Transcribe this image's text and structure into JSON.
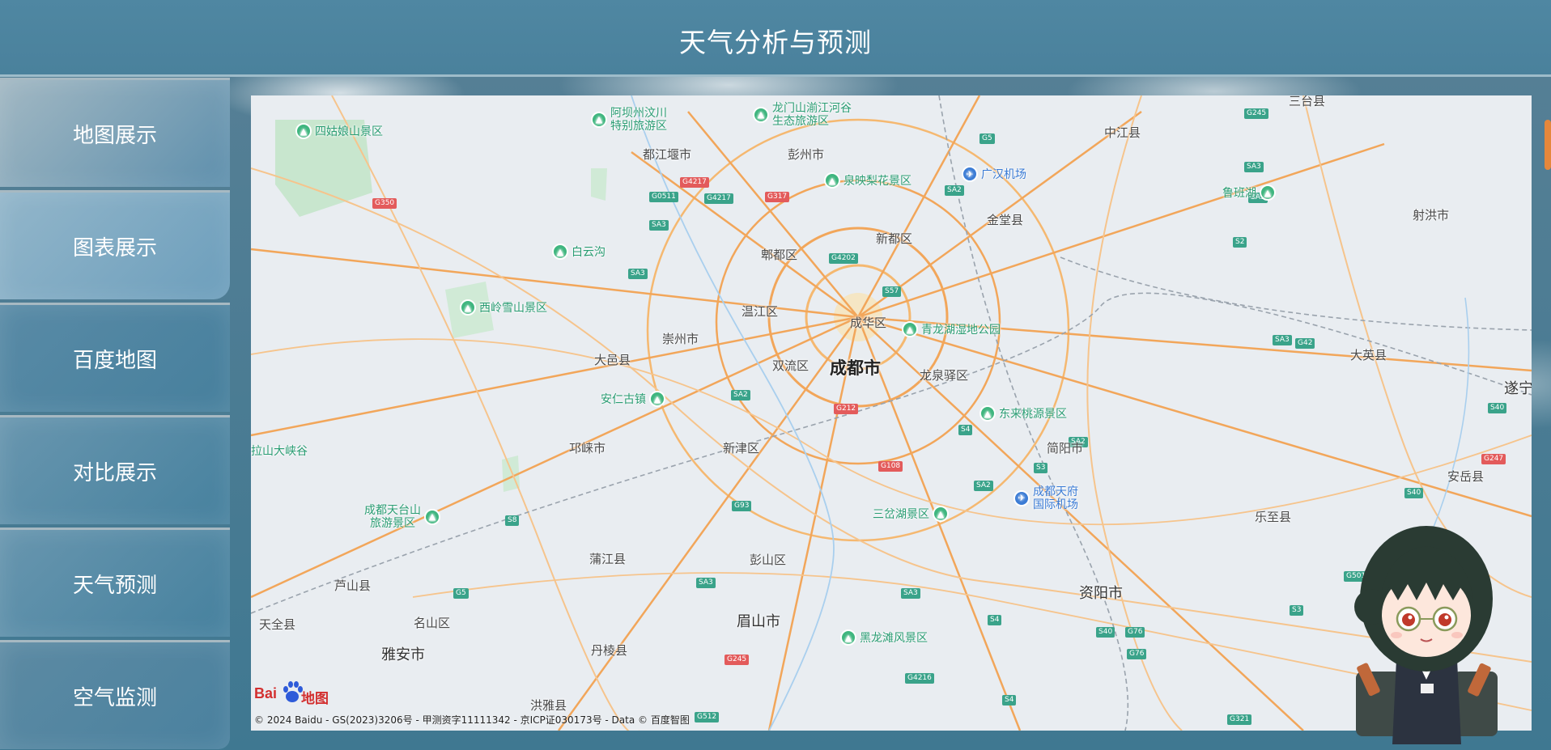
{
  "header": {
    "title": "天气分析与预测"
  },
  "sidebar": {
    "items": [
      {
        "label": "地图展示"
      },
      {
        "label": "图表展示"
      },
      {
        "label": "百度地图"
      },
      {
        "label": "对比展示"
      },
      {
        "label": "天气预测"
      },
      {
        "label": "空气监测"
      }
    ]
  },
  "map": {
    "places": {
      "chengdu": "成都市",
      "chenghua": "成华区",
      "xindu": "新都区",
      "pidu": "郫都区",
      "wenjiang": "温江区",
      "shuangliu": "双流区",
      "longquanyi": "龙泉驿区",
      "chongzhou": "崇州市",
      "dayi": "大邑县",
      "qionglai": "邛崃市",
      "xinjin": "新津区",
      "dujiangyan": "都江堰市",
      "pengzhou": "彭州市",
      "jintang": "金堂县",
      "zhongjiang": "中江县",
      "jianyang": "简阳市",
      "ziyang": "资阳市",
      "pujiang": "蒲江县",
      "pengshan": "彭山区",
      "meishan": "眉山市",
      "danling": "丹棱县",
      "mingshan": "名山区",
      "yaan": "雅安市",
      "lushan": "芦山县",
      "tianquan": "天全县",
      "hongya": "洪雅县",
      "lezhi": "乐至县",
      "anyue": "安岳县",
      "daying": "大英县",
      "shehong": "射洪市",
      "santai": "三台县",
      "suining": "遂宁"
    },
    "pois": {
      "siguniang": "四姑娘山景区",
      "aba": "阿坝州汶川\n特别旅游区",
      "longmenshan": "龙门山湔江河谷\n生态旅游区",
      "quanyin": "泉映梨花景区",
      "guanghan": "广汉机场",
      "baiyungou": "白云沟",
      "xiling": "西岭雪山景区",
      "qinglonghu": "青龙湖湿地公园",
      "anren": "安仁古镇",
      "dongtao": "东来桃源景区",
      "tianfu": "成都天府\n国际机场",
      "sanchahu": "三岔湖景区",
      "tiantaishan": "成都天台山\n旅游景区",
      "heilongtan": "黑龙滩风景区",
      "lujianghu": "鲁班湖",
      "lalashan": "拉山大峡谷"
    },
    "logo_text": {
      "bai": "Bai",
      "map": "地图"
    },
    "copyright": "© 2024 Baidu - GS(2023)3206号 - 甲测资字11111342 - 京ICP证030173号 - Data © 百度智图"
  },
  "colors": {
    "header_bg": "#4a819c",
    "sidebar_border": "#a7b9c2",
    "accent_scroll": "#e5873b",
    "road_major": "#f2a65a",
    "poi_green": "#3fb67f"
  }
}
